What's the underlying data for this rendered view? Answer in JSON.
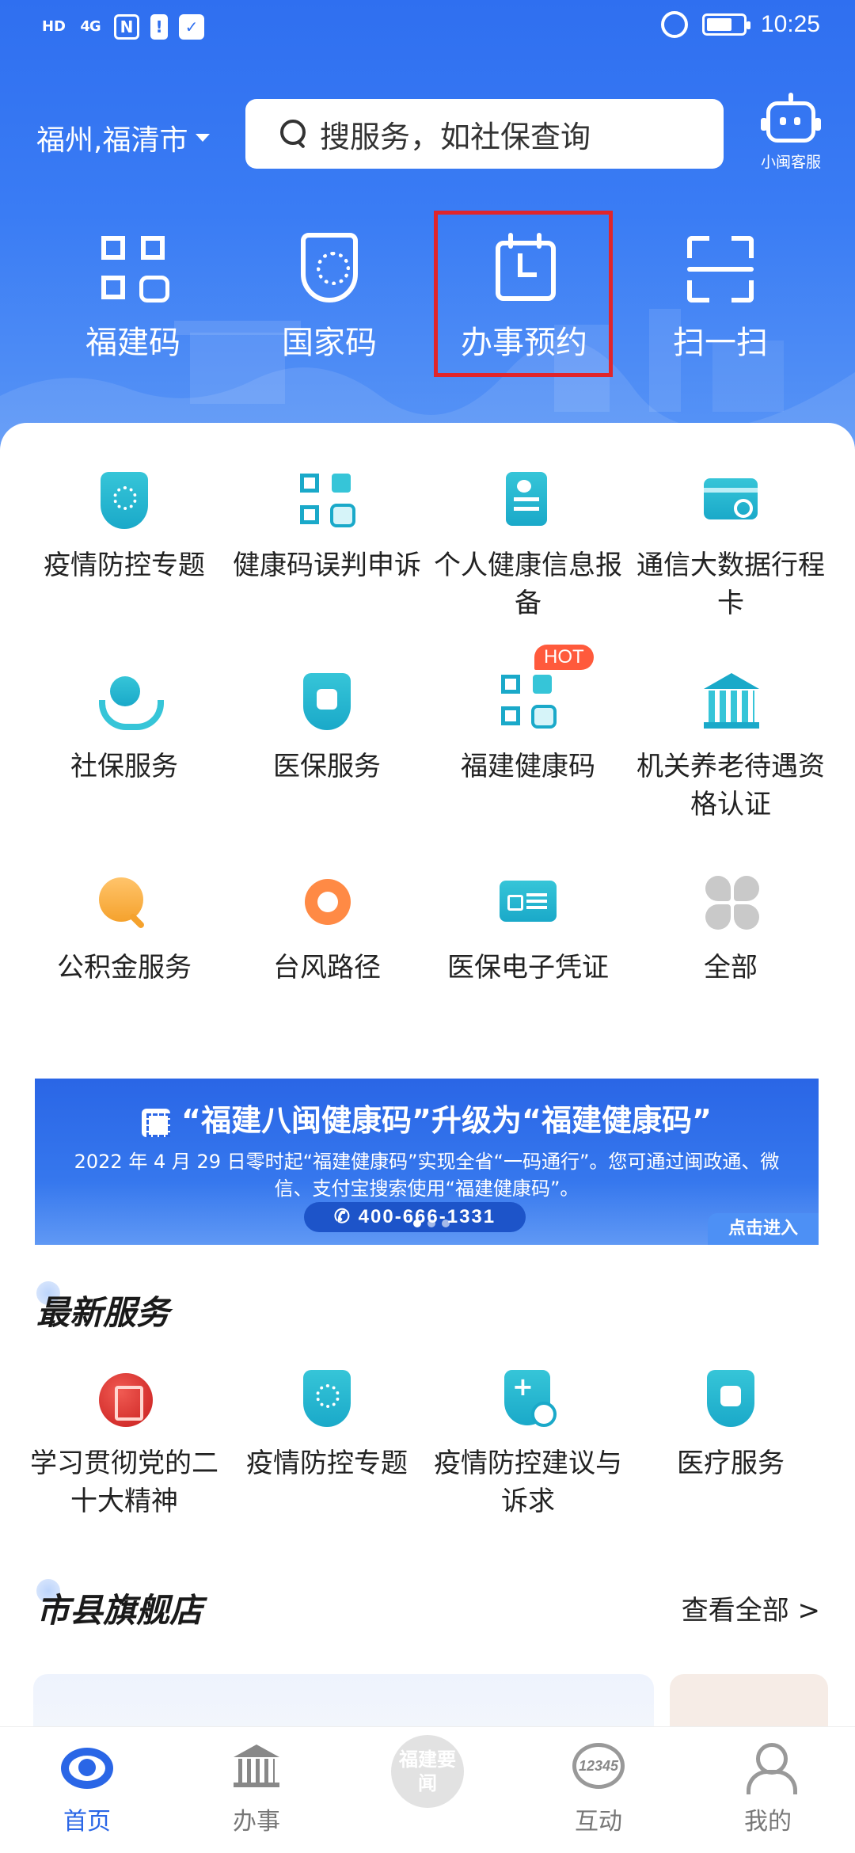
{
  "status_bar": {
    "hd": "HD",
    "network": "4G",
    "nfc": "N",
    "alert": "!",
    "time": "10:25",
    "battery_level": 0.7
  },
  "header": {
    "location": "福州,福清市",
    "search_placeholder": "搜服务，如社保查询",
    "customer_service_label": "小闽客服"
  },
  "quick_actions": [
    {
      "label": "福建码",
      "icon": "qr-health-icon"
    },
    {
      "label": "国家码",
      "icon": "shield-qr-icon"
    },
    {
      "label": "办事预约",
      "icon": "calendar-icon",
      "highlighted": true
    },
    {
      "label": "扫一扫",
      "icon": "scan-icon"
    }
  ],
  "services": [
    {
      "label": "疫情防控专题",
      "icon": "shield-virus-icon"
    },
    {
      "label": "健康码误判申诉",
      "icon": "qr-message-icon"
    },
    {
      "label": "个人健康信息报备",
      "icon": "document-edit-icon"
    },
    {
      "label": "通信大数据行程卡",
      "icon": "card-icon"
    },
    {
      "label": "社保服务",
      "icon": "hands-care-icon"
    },
    {
      "label": "医保服务",
      "icon": "medical-shield-icon"
    },
    {
      "label": "福建健康码",
      "icon": "qr-health-icon",
      "badge": "HOT"
    },
    {
      "label": "机关养老待遇资格认证",
      "icon": "bank-id-icon"
    },
    {
      "label": "公积金服务",
      "icon": "house-search-icon"
    },
    {
      "label": "台风路径",
      "icon": "typhoon-icon"
    },
    {
      "label": "医保电子凭证",
      "icon": "medical-card-icon"
    },
    {
      "label": "全部",
      "icon": "all-grid-icon"
    }
  ],
  "banner": {
    "title": "“福建八闽健康码”升级为“福建健康码”",
    "text": "2022 年 4 月 29 日零时起“福建健康码”实现全省“一码通行”。您可通过闽政通、微信、支付宝搜索使用“福建健康码”。",
    "phone": "400-666-1331",
    "enter_label": "点击进入"
  },
  "latest": {
    "title": "最新服务",
    "items": [
      {
        "label": "学习贯彻党的二十大精神",
        "icon": "party-study-icon"
      },
      {
        "label": "疫情防控专题",
        "icon": "shield-virus-icon"
      },
      {
        "label": "疫情防控建议与诉求",
        "icon": "shield-plus-icon"
      },
      {
        "label": "医疗服务",
        "icon": "medical-shield-icon"
      }
    ]
  },
  "flagship": {
    "title": "市县旗舰店",
    "see_all": "查看全部 >"
  },
  "bottom_nav": [
    {
      "label": "首页",
      "icon": "home-icon",
      "active": true
    },
    {
      "label": "办事",
      "icon": "government-building-icon"
    },
    {
      "label": "福建要闻",
      "icon": "news-icon"
    },
    {
      "label": "互动",
      "icon": "hotline-12345-icon",
      "badge_text": "12345"
    },
    {
      "label": "我的",
      "icon": "profile-icon"
    }
  ],
  "colors": {
    "brand_blue": "#2f6ff0",
    "accent_teal": "#1aa9c9",
    "highlight_red": "#e0252b",
    "hot_badge": "#ff5a3c"
  }
}
